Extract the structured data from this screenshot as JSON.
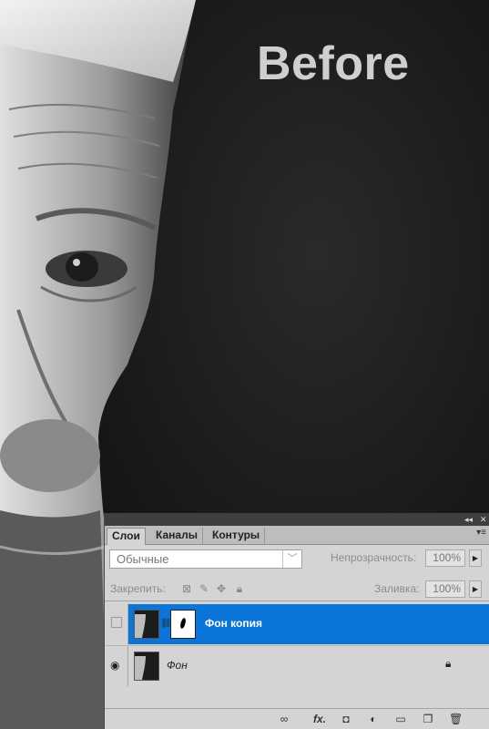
{
  "photo": {
    "overlay_text": "Before"
  },
  "panel": {
    "window_controls": [
      "◂◂",
      "✕"
    ],
    "tabs": [
      "Слои",
      "Каналы",
      "Контуры"
    ],
    "menu_icon": "panel-menu-icon",
    "blend_mode": "Обычные",
    "opacity_label": "Непрозрачность:",
    "opacity_value": "100%",
    "lock_label": "Закрепить:",
    "fill_label": "Заливка:",
    "fill_value": "100%",
    "layers": [
      {
        "name": "Фон копия",
        "selected": true,
        "visible": false,
        "has_mask": true,
        "locked": false
      },
      {
        "name": "Фон",
        "selected": false,
        "visible": true,
        "has_mask": false,
        "locked": true
      }
    ],
    "bottom_icons": [
      "link-layers-icon",
      "fx-icon",
      "add-mask-icon",
      "adjustment-layer-icon",
      "new-group-icon",
      "new-layer-icon",
      "delete-layer-icon"
    ],
    "fx_label": "fx."
  },
  "colors": {
    "selection": "#0b74d8",
    "panel_bg": "#d4d4d4",
    "photo_bg": "#151515"
  }
}
